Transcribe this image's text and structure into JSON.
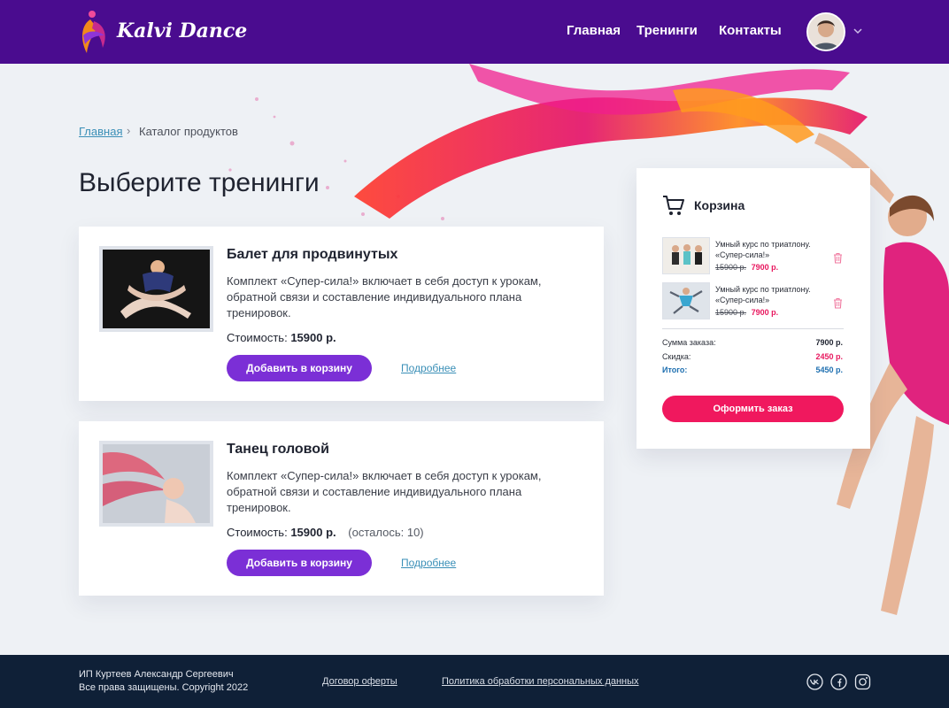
{
  "brand": {
    "name": "Kalvi Dance"
  },
  "nav": {
    "items": [
      "Главная",
      "Тренинги",
      "Контакты"
    ]
  },
  "icons": {
    "logo": "dancer-logo-icon",
    "user_menu": "chevron-down-icon",
    "cart": "shopping-cart-icon",
    "delete": "trash-icon",
    "social": [
      "vk-icon",
      "facebook-icon",
      "instagram-icon"
    ]
  },
  "breadcrumb": {
    "home": "Главная",
    "separator": "›",
    "current": "Каталог продуктов"
  },
  "page": {
    "title": "Выберите тренинги"
  },
  "products": [
    {
      "title": "Балет для продвинутых",
      "description": "Комплект «Супер-сила!» включает в себя доступ к урокам, обратной связи и составление индивидуального плана тренировок.",
      "price_label": "Стоимость:",
      "price": "15900 р.",
      "remaining": "",
      "add_label": "Добавить в корзину",
      "more_label": "Подробнее"
    },
    {
      "title": "Танец головой",
      "description": "Комплект «Супер-сила!» включает в себя доступ к урокам, обратной связи и составление индивидуального плана тренировок.",
      "price_label": "Стоимость:",
      "price": "15900 р.",
      "remaining": "(осталось: 10)",
      "add_label": "Добавить в корзину",
      "more_label": "Подробнее"
    }
  ],
  "cart": {
    "title": "Корзина",
    "items": [
      {
        "name": "Умный курс по триатлону. «Супер-сила!»",
        "old_price": "15900 р.",
        "new_price": "7900 р."
      },
      {
        "name": "Умный курс по триатлону. «Супер-сила!»",
        "old_price": "15900 р.",
        "new_price": "7900 р."
      }
    ],
    "summary": [
      {
        "label": "Сумма заказа:",
        "value": "7900 р."
      },
      {
        "label": "Скидка:",
        "value": "2450 р."
      },
      {
        "label": "Итого:",
        "value": "5450 р."
      }
    ],
    "checkout_label": "Оформить заказ"
  },
  "footer": {
    "owner": "ИП Куртеев Александр Сергеевич",
    "rights": "Все права защищены. Copyright 2022",
    "links": [
      "Договор оферты",
      "Политика обработки персональных данных"
    ]
  },
  "colors": {
    "header": "#4a0c8f",
    "primary_button": "#7b2fd6",
    "order_button": "#f0185e",
    "price_accent": "#e8185f",
    "link": "#3a8fb7",
    "total_label": "#1e6fb0",
    "footer": "#0f2037"
  }
}
